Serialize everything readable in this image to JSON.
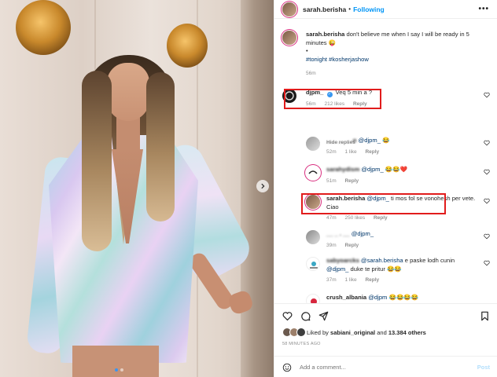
{
  "post": {
    "author": "sarah.berisha",
    "follow_separator": "•",
    "follow_label": "Following",
    "more_label": "•••",
    "caption_text": "don't believe me when I say I will be ready in 5 minutes",
    "caption_emoji": "😜",
    "caption_bullet": "•",
    "hashtags": [
      "#tonight",
      "#kosherjashow"
    ],
    "caption_time": "56m",
    "carousel": {
      "slides": 2,
      "active_index": 0
    }
  },
  "comments": [
    {
      "user": "djpm_",
      "verified": true,
      "text": "Veq 5 min a ?",
      "time": "56m",
      "likes": "212 likes",
      "reply": "Reply"
    },
    {
      "user": "",
      "mention": "@djpm_",
      "text": "😂",
      "time": "52m",
      "likes": "1 like",
      "reply": "Reply"
    },
    {
      "user": "sarahydism",
      "mention": "@djpm_",
      "text": "😂😂❤️",
      "time": "51m",
      "reply": "Reply"
    },
    {
      "user": "sarah.berisha",
      "mention": "@djpm_",
      "text": "ti mos fol se vonohesh per vete. Ciao",
      "time": "47m",
      "likes": "250 likes",
      "reply": "Reply"
    },
    {
      "user": "",
      "mention": "@djpm_",
      "text": "",
      "time": "39m",
      "reply": "Reply"
    },
    {
      "user": "sabyoarcks",
      "mention": "@sarah.berisha",
      "text_a": "e paske lodh cunin",
      "mention2": "@djpm_",
      "text_b": "duke te pritur 😂😂",
      "time": "37m",
      "likes": "1 like",
      "reply": "Reply"
    },
    {
      "user": "crush_albania",
      "mention": "@djpm",
      "text": "😂😂😂😂"
    }
  ],
  "hide_replies_label": "Hide replies",
  "likes_bar": {
    "prefix": "Liked by",
    "user": "sabiani_original",
    "middle": "and",
    "count": "13.384 others"
  },
  "time_ago": "58 MINUTES AGO",
  "add_comment": {
    "placeholder": "Add a comment...",
    "post_label": "Post"
  },
  "colors": {
    "accent": "#0095f6",
    "highlight_box": "#e11c1c",
    "story_ring": "#d92e7f"
  }
}
